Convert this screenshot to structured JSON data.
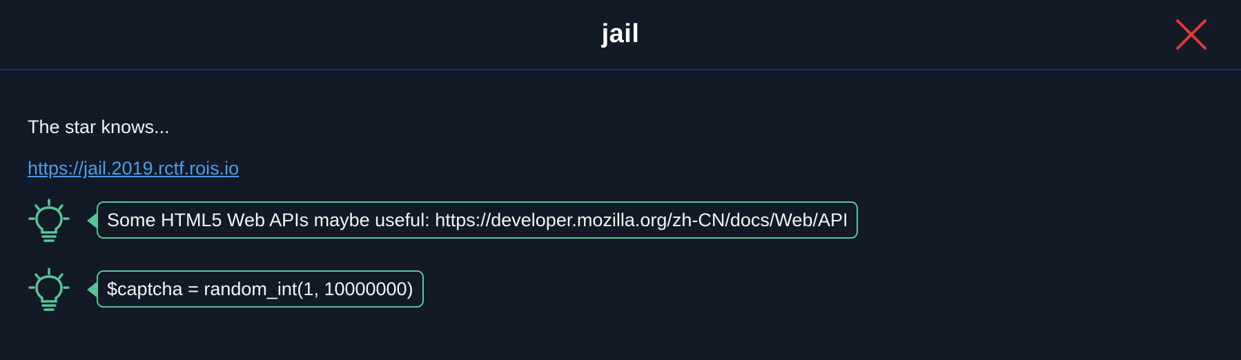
{
  "modal": {
    "title": "jail",
    "close_icon": "close-icon",
    "close_color": "#e8392f"
  },
  "challenge": {
    "description": "The star knows...",
    "link": "https://jail.2019.rctf.rois.io"
  },
  "hints": [
    {
      "icon": "lightbulb-icon",
      "text": "Some HTML5 Web APIs maybe useful: https://developer.mozilla.org/zh-CN/docs/Web/API"
    },
    {
      "icon": "lightbulb-icon",
      "text": "$captcha = random_int(1, 10000000)"
    }
  ],
  "colors": {
    "background": "#111a26",
    "accent_green": "#5ac59a",
    "link_blue": "#4f9de6",
    "divider": "#1e3a5c"
  }
}
